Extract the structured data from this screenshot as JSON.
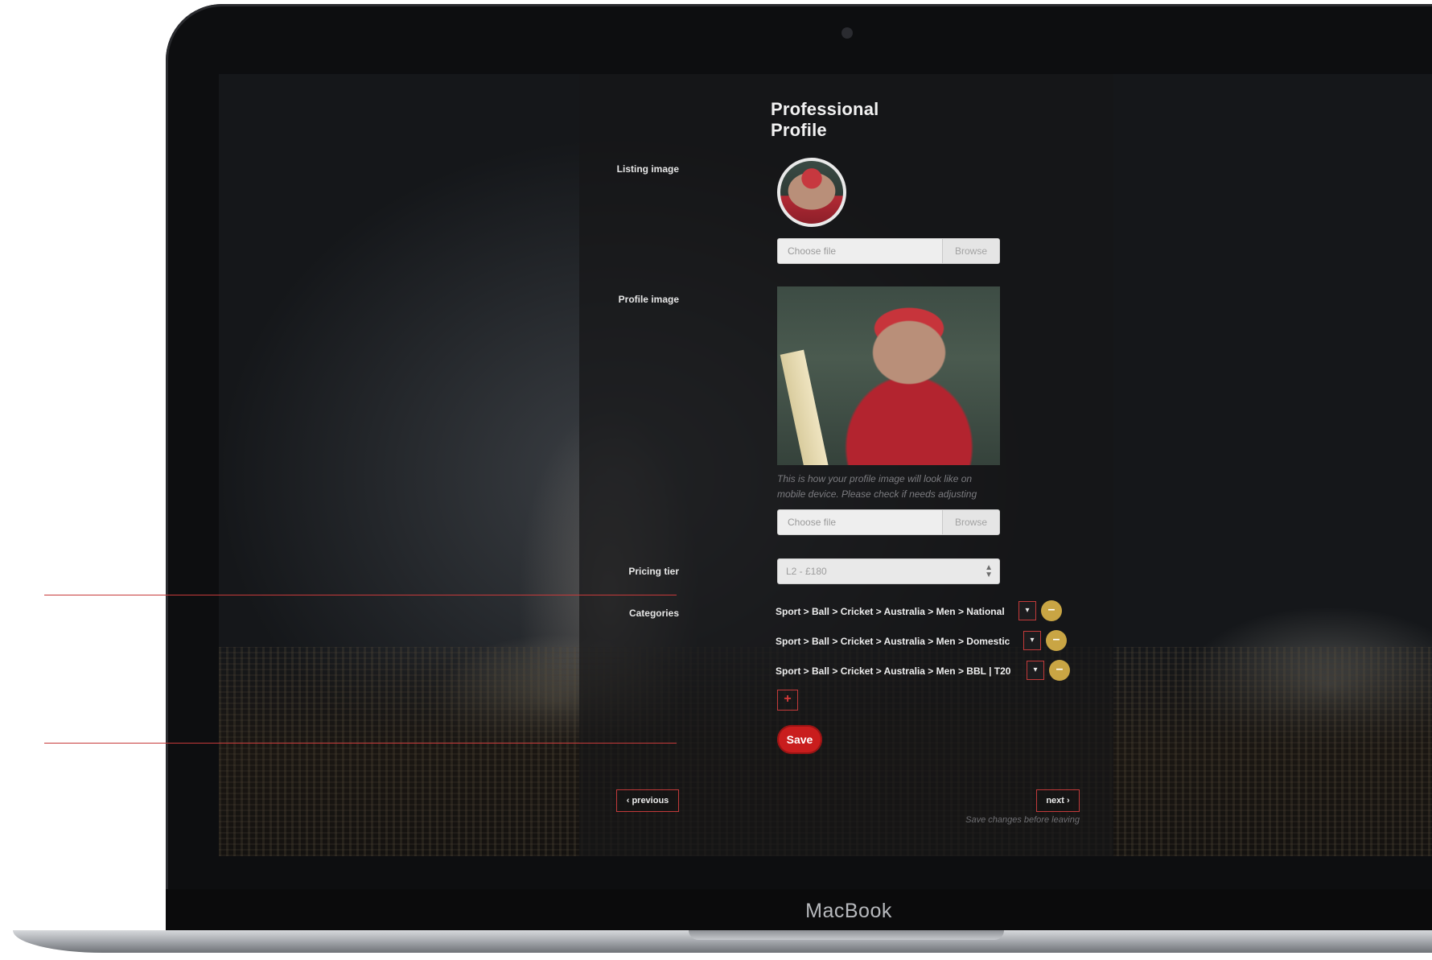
{
  "device": {
    "brand": "MacBook"
  },
  "page": {
    "title": "Professional Profile"
  },
  "listing_image": {
    "label": "Listing image",
    "file_placeholder": "Choose file",
    "browse_label": "Browse"
  },
  "profile_image": {
    "label": "Profile image",
    "hint": "This is how your profile image will look like on mobile device. Please check if needs adjusting",
    "file_placeholder": "Choose file",
    "browse_label": "Browse"
  },
  "pricing": {
    "label": "Pricing tier",
    "selected": "L2 - £180"
  },
  "categories": {
    "label": "Categories",
    "items": [
      {
        "path": "Sport > Ball > Cricket > Australia > Men > National"
      },
      {
        "path": "Sport > Ball > Cricket > Australia > Men > Domestic"
      },
      {
        "path": "Sport > Ball > Cricket > Australia > Men > BBL | T20"
      }
    ],
    "add_label": "+",
    "remove_label": "–",
    "dropdown_label": "▾"
  },
  "actions": {
    "save_label": "Save",
    "previous_label": "previous",
    "next_label": "next",
    "leave_note": "Save changes before leaving"
  },
  "colors": {
    "accent": "#c91d1d",
    "remove": "#c9a544",
    "panel": "#161618"
  }
}
